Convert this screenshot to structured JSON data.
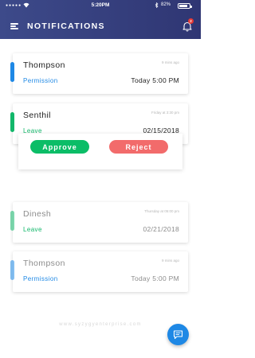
{
  "status_bar": {
    "time": "5:20PM",
    "battery_text": "82%",
    "battery_level": 0.82,
    "signal_icon": "signal-dots-icon",
    "wifi_icon": "wifi-icon",
    "bluetooth_icon": "bluetooth-icon"
  },
  "header": {
    "title": "NOTIFICATIONS",
    "menu_icon": "hamburger-menu-icon",
    "bell_icon": "bell-icon",
    "badge_count": "2"
  },
  "notifications": [
    {
      "name": "Thompson",
      "timestamp": "9 mins ago",
      "type": "Permission",
      "type_color": "#1e88e5",
      "when": "Today 5:00 PM",
      "faded": false
    },
    {
      "name": "Senthil",
      "timestamp": "Friday at 3:30 pm",
      "type": "Leave",
      "type_color": "#12b76a",
      "when": "02/15/2018",
      "faded": false
    },
    {
      "name": "Dinesh",
      "timestamp": "Thursday at 05:00 pm",
      "type": "Leave",
      "type_color": "#12b76a",
      "when": "02/21/2018",
      "faded": true
    },
    {
      "name": "Thompson",
      "timestamp": "9 mins ago",
      "type": "Permission",
      "type_color": "#1e88e5",
      "when": "Today 5:00 PM",
      "faded": true
    }
  ],
  "actions": {
    "approve_label": "Approve",
    "reject_label": "Reject",
    "approve_color": "#0bbd67",
    "reject_color": "#f26b6b"
  },
  "footer": {
    "text": "www.syzygyenterprise.com",
    "chat_icon": "chat-bubble-icon"
  },
  "colors": {
    "header_start": "#3d4a8a",
    "header_end": "#2f3673",
    "badge": "#e53935"
  }
}
